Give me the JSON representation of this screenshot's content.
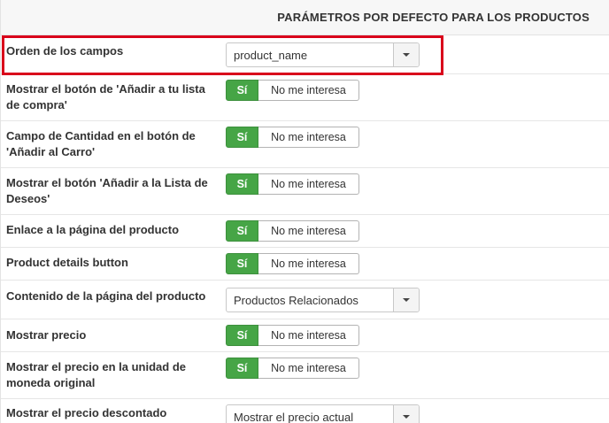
{
  "header": {
    "title": "PARÁMETROS POR DEFECTO PARA LOS PRODUCTOS"
  },
  "toggle_labels": {
    "yes": "Sí",
    "no": "No me interesa"
  },
  "rows": [
    {
      "label": "Orden de los campos",
      "type": "select",
      "value": "product_name"
    },
    {
      "label": "Mostrar el botón de 'Añadir a tu lista de compra'",
      "type": "toggle",
      "selected": "yes"
    },
    {
      "label": "Campo de Cantidad en el botón de 'Añadir al Carro'",
      "type": "toggle",
      "selected": "yes"
    },
    {
      "label": "Mostrar el botón 'Añadir a la Lista de Deseos'",
      "type": "toggle",
      "selected": "yes"
    },
    {
      "label": "Enlace a la página del producto",
      "type": "toggle",
      "selected": "yes"
    },
    {
      "label": "Product details button",
      "type": "toggle",
      "selected": "yes"
    },
    {
      "label": "Contenido de la página del producto",
      "type": "select",
      "value": "Productos Relacionados"
    },
    {
      "label": "Mostrar precio",
      "type": "toggle",
      "selected": "yes"
    },
    {
      "label": "Mostrar el precio en la unidad de moneda original",
      "type": "toggle",
      "selected": "yes"
    },
    {
      "label": "Mostrar el precio descontado",
      "type": "select",
      "value": "Mostrar el precio actual"
    }
  ],
  "colors": {
    "toggle_active": "#46a546",
    "highlight_border": "#d9001b",
    "header_bg": "#f7f7f7"
  }
}
